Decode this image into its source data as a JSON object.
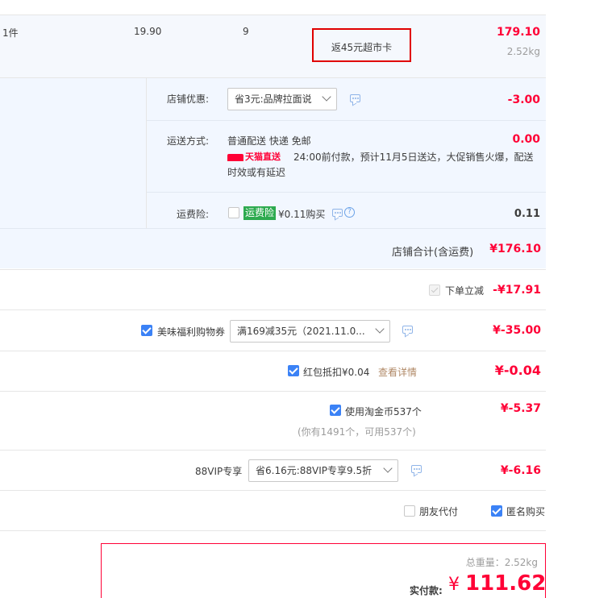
{
  "item": {
    "qty_unit": "1件",
    "price": "19.90",
    "quantity": "9",
    "rebate_tag": "返45元超市卡",
    "subtotal": "179.10",
    "weight": "2.52kg"
  },
  "shop": {
    "discount_label": "店铺优惠:",
    "discount_select": "省3元:品牌拉面说",
    "discount_amount": "-3.00",
    "shipping_label": "运送方式:",
    "shipping_method": "普通配送 快递 免邮",
    "shipping_fee": "0.00",
    "tmall_badge": "天猫直送",
    "shipping_note_1": "24:00前付款，预计11月5日送达，大促销售火爆，配送",
    "shipping_note_2": "时效或有延迟",
    "insurance_label": "运费险:",
    "insurance_tag": "运费险",
    "insurance_price": "¥0.11购买",
    "insurance_amount": "0.11",
    "total_label": "店铺合计(含运费)",
    "total_value": "¥176.10"
  },
  "discounts": {
    "instant_label": "下单立减",
    "instant_value": "-¥17.91",
    "coupon_label": "美味福利购物券",
    "coupon_select": "满169减35元（2021.11.0...",
    "coupon_value": "¥-35.00",
    "redpack_label": "红包抵扣¥0.04",
    "redpack_link": "查看详情",
    "redpack_value": "¥-0.04",
    "coins_label": "使用淘金币537个",
    "coins_note": "(你有1491个，可用537个)",
    "coins_value": "¥-5.37",
    "vip_label": "88VIP专享",
    "vip_select": "省6.16元:88VIP专享9.5折",
    "vip_value": "¥-6.16"
  },
  "options": {
    "friend_pay": "朋友代付",
    "anonymous": "匿名购买"
  },
  "summary": {
    "weight_line": "总重量：2.52kg",
    "pay_label": "实付款:",
    "currency": "¥",
    "pay_value": "111.62"
  },
  "colors": {
    "accent_red": "#ff0036",
    "check_blue": "#3b82f6",
    "pane_bg": "#f2f7ff",
    "badge_green": "#2daa4f"
  }
}
